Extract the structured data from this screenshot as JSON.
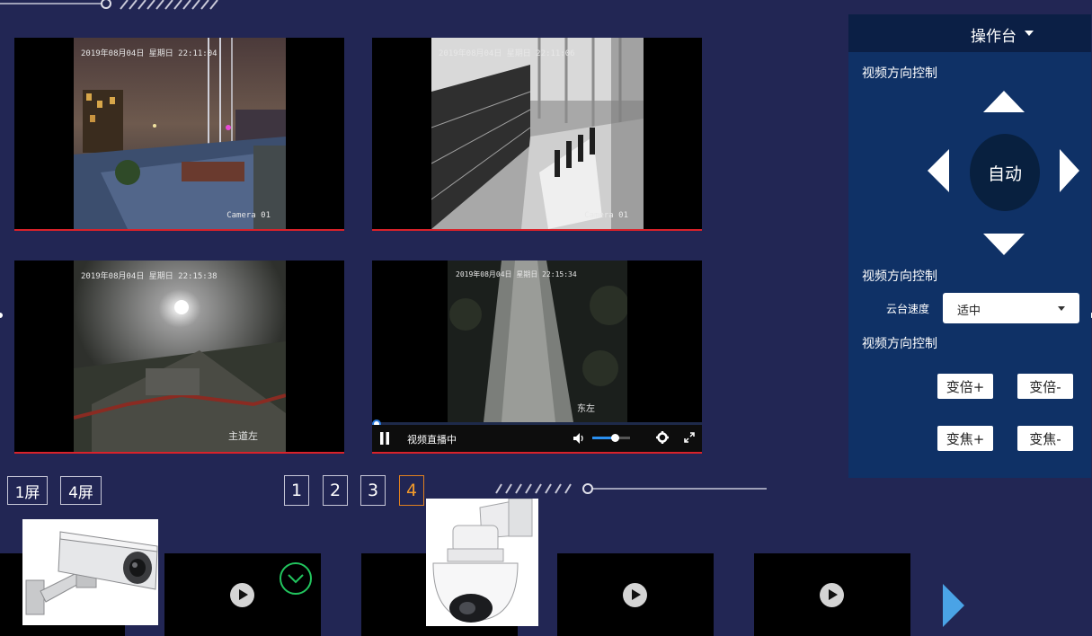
{
  "videos": [
    {
      "timestamp": "2019年08月04日 星期日 22:11:04",
      "camera_label": "Camera 01"
    },
    {
      "timestamp": "2019年08月04日 星期日 22:11:06",
      "camera_label": "Camera 01"
    },
    {
      "timestamp": "2019年08月04日 星期日 22:15:38",
      "camera_label": "主道左"
    },
    {
      "timestamp": "2019年08月04日 星期日 22:15:34",
      "camera_label": "东左"
    }
  ],
  "player": {
    "status": "视频直播中",
    "volume_percent": 60,
    "progress_percent": 0,
    "icons": [
      "pause-icon",
      "volume-icon",
      "settings-icon",
      "fullscreen-icon"
    ]
  },
  "panel": {
    "title": "操作台",
    "direction_title": "视频方向控制",
    "auto_label": "自动",
    "speed_section_title": "视频方向控制",
    "speed_label": "云台速度",
    "speed_value": "适中",
    "zoom_section_title": "视频方向控制",
    "zoom_in": "变倍+",
    "zoom_out": "变倍-",
    "focus_in": "变焦+",
    "focus_out": "变焦-"
  },
  "layout_buttons": [
    "1屏",
    "4屏"
  ],
  "pager": {
    "pages": [
      "1",
      "2",
      "3",
      "4"
    ],
    "active": "4"
  },
  "colors": {
    "background": "#222654",
    "panel": "#0f3166",
    "panel_header": "#0b1f45",
    "accent": "#f39a2a",
    "video_border": "#d9222a",
    "selected_check": "#22c55e",
    "next_arrow": "#4aa3e6"
  }
}
